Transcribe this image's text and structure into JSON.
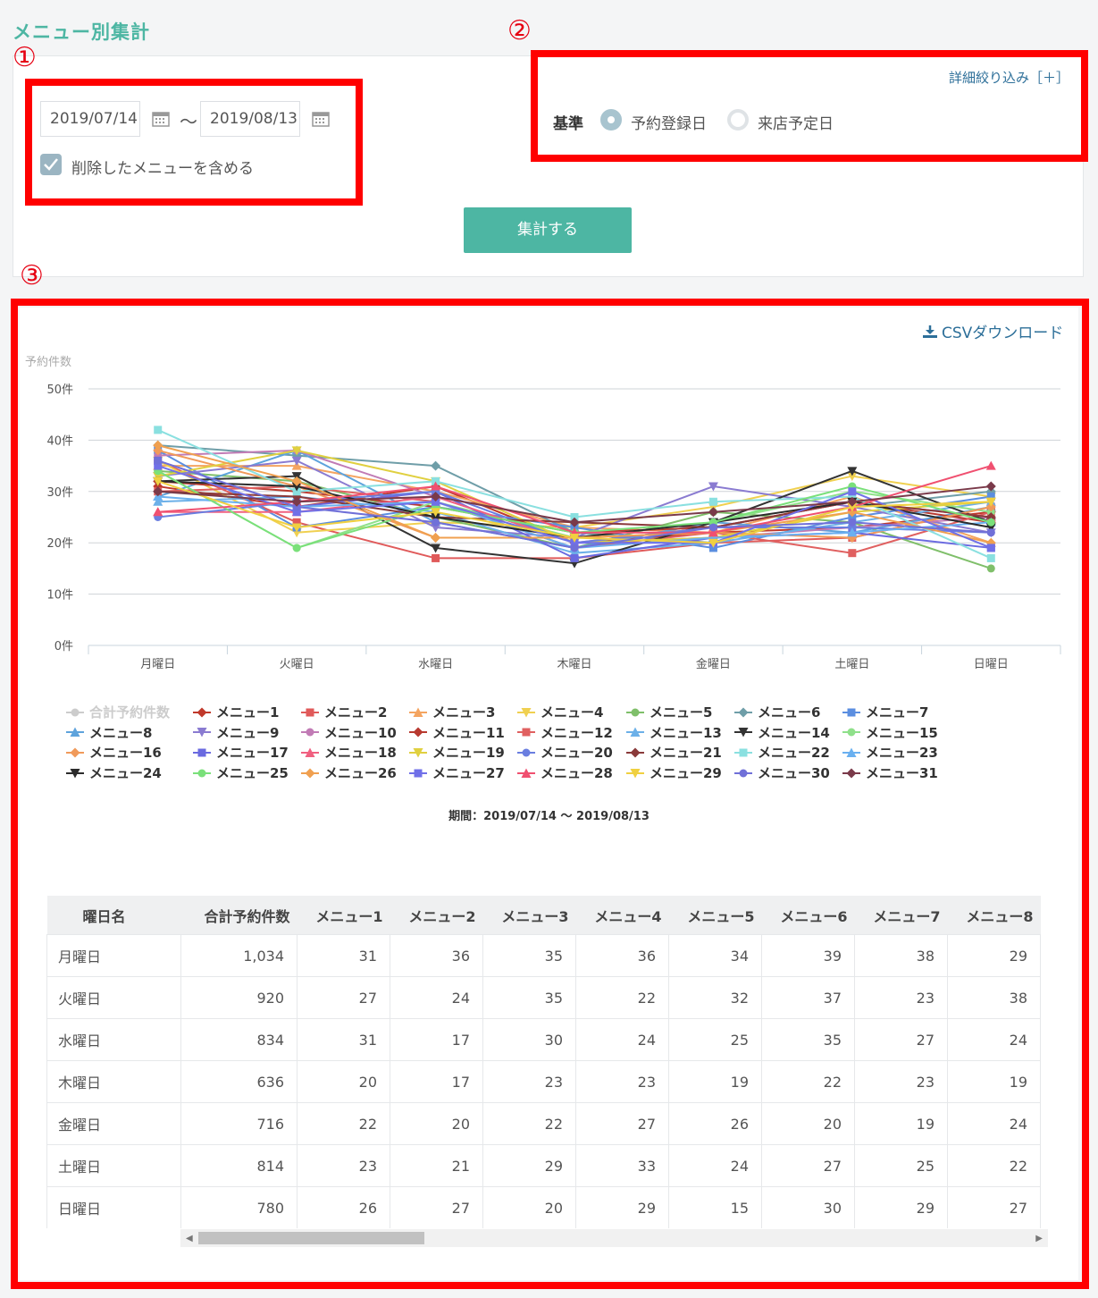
{
  "page": {
    "title": "メニュー別集計"
  },
  "markers": [
    "①",
    "②",
    "③"
  ],
  "filters": {
    "date_from": "2019/07/14",
    "tilde": "〜",
    "date_to": "2019/08/13",
    "include_deleted_label": "削除したメニューを含める",
    "include_deleted_checked": true,
    "detail_filter_link": "詳細絞り込み［＋］",
    "basis_label": "基準",
    "basis_options": [
      "予約登録日",
      "来店予定日"
    ],
    "basis_selected": "予約登録日",
    "submit_label": "集計する"
  },
  "result": {
    "csv_download_label": "CSVダウンロード",
    "period_text": "期間：2019/07/14 〜 2019/08/13"
  },
  "chart_data": {
    "type": "line",
    "ylabel": "予約件数",
    "ylim": [
      0,
      50
    ],
    "yticks": [
      "0件",
      "10件",
      "20件",
      "30件",
      "40件",
      "50件"
    ],
    "categories": [
      "月曜日",
      "火曜日",
      "水曜日",
      "木曜日",
      "金曜日",
      "土曜日",
      "日曜日"
    ],
    "legend_hidden": "合計予約件数",
    "series": [
      {
        "name": "合計予約件数",
        "color": "#cccccc",
        "marker": "circle",
        "visible": false,
        "values": [
          1034,
          920,
          834,
          636,
          716,
          814,
          780
        ]
      },
      {
        "name": "メニュー1",
        "color": "#c0392b",
        "marker": "diamond",
        "values": [
          31,
          27,
          31,
          20,
          22,
          23,
          26
        ]
      },
      {
        "name": "メニュー2",
        "color": "#e05a5a",
        "marker": "square",
        "values": [
          36,
          24,
          17,
          17,
          20,
          21,
          27
        ]
      },
      {
        "name": "メニュー3",
        "color": "#f4a460",
        "marker": "triangle",
        "values": [
          35,
          35,
          30,
          23,
          22,
          29,
          20
        ]
      },
      {
        "name": "メニュー4",
        "color": "#f0d050",
        "marker": "triangle-down",
        "values": [
          36,
          22,
          24,
          23,
          27,
          33,
          29
        ]
      },
      {
        "name": "メニュー5",
        "color": "#7fbf6a",
        "marker": "circle",
        "values": [
          34,
          32,
          25,
          19,
          26,
          24,
          15
        ]
      },
      {
        "name": "メニュー6",
        "color": "#6f9ea8",
        "marker": "diamond",
        "values": [
          39,
          37,
          35,
          22,
          20,
          27,
          30
        ]
      },
      {
        "name": "メニュー7",
        "color": "#5b8ee0",
        "marker": "square",
        "values": [
          38,
          23,
          27,
          23,
          19,
          25,
          29
        ]
      },
      {
        "name": "メニュー8",
        "color": "#5ea3dc",
        "marker": "triangle",
        "values": [
          29,
          38,
          24,
          19,
          24,
          22,
          27
        ]
      },
      {
        "name": "メニュー9",
        "color": "#8a7bd1",
        "marker": "triangle-down",
        "values": [
          33,
          36,
          23,
          21,
          31,
          27,
          22
        ]
      },
      {
        "name": "メニュー10",
        "color": "#c17bb5",
        "marker": "circle",
        "values": [
          37,
          38,
          29,
          20,
          21,
          23,
          25
        ]
      },
      {
        "name": "メニュー11",
        "color": "#b83a30",
        "marker": "diamond",
        "values": [
          32,
          30,
          27,
          22,
          23,
          28,
          24
        ]
      },
      {
        "name": "メニュー12",
        "color": "#e06060",
        "marker": "square",
        "values": [
          30,
          31,
          28,
          19,
          22,
          18,
          26
        ]
      },
      {
        "name": "メニュー13",
        "color": "#6cb0e8",
        "marker": "triangle",
        "values": [
          28,
          29,
          26,
          18,
          20,
          24,
          28
        ]
      },
      {
        "name": "メニュー14",
        "color": "#333333",
        "marker": "triangle-down",
        "values": [
          32,
          33,
          19,
          16,
          24,
          34,
          24
        ]
      },
      {
        "name": "メニュー15",
        "color": "#8fe08a",
        "marker": "circle",
        "values": [
          34,
          19,
          28,
          21,
          24,
          30,
          26
        ]
      },
      {
        "name": "メニュー16",
        "color": "#f09a5a",
        "marker": "diamond",
        "values": [
          38,
          31,
          21,
          21,
          22,
          21,
          27
        ]
      },
      {
        "name": "メニュー17",
        "color": "#6a6ae0",
        "marker": "square",
        "values": [
          36,
          27,
          30,
          17,
          21,
          22,
          19
        ]
      },
      {
        "name": "メニュー18",
        "color": "#f06080",
        "marker": "triangle",
        "values": [
          26,
          26,
          29,
          20,
          23,
          28,
          25
        ]
      },
      {
        "name": "メニュー19",
        "color": "#e0d040",
        "marker": "triangle-down",
        "values": [
          33,
          38,
          32,
          20,
          21,
          26,
          28
        ]
      },
      {
        "name": "メニュー20",
        "color": "#6a7ee0",
        "marker": "circle",
        "values": [
          25,
          28,
          30,
          20,
          23,
          23,
          22
        ]
      },
      {
        "name": "メニュー21",
        "color": "#8a3a3a",
        "marker": "diamond",
        "values": [
          30,
          29,
          25,
          24,
          23,
          28,
          25
        ]
      },
      {
        "name": "メニュー22",
        "color": "#8ae0e0",
        "marker": "square",
        "values": [
          42,
          30,
          32,
          25,
          28,
          29,
          17
        ]
      },
      {
        "name": "メニュー23",
        "color": "#6ab0f0",
        "marker": "triangle",
        "values": [
          29,
          27,
          28,
          19,
          21,
          22,
          24
        ]
      },
      {
        "name": "メニュー24",
        "color": "#2b2b2b",
        "marker": "triangle-down",
        "values": [
          32,
          31,
          25,
          21,
          24,
          28,
          23
        ]
      },
      {
        "name": "メニュー25",
        "color": "#7ae07a",
        "marker": "circle",
        "values": [
          34,
          19,
          27,
          22,
          24,
          31,
          24
        ]
      },
      {
        "name": "メニュー26",
        "color": "#f0a050",
        "marker": "diamond",
        "values": [
          39,
          32,
          21,
          21,
          22,
          26,
          20
        ]
      },
      {
        "name": "メニュー27",
        "color": "#7070e8",
        "marker": "square",
        "values": [
          35,
          26,
          28,
          20,
          20,
          30,
          19
        ]
      },
      {
        "name": "メニュー28",
        "color": "#f05070",
        "marker": "triangle",
        "values": [
          26,
          28,
          31,
          22,
          22,
          27,
          35
        ]
      },
      {
        "name": "メニュー29",
        "color": "#f0d040",
        "marker": "triangle-down",
        "values": [
          32,
          23,
          26,
          21,
          20,
          27,
          28
        ]
      },
      {
        "name": "メニュー30",
        "color": "#7070d8",
        "marker": "circle",
        "values": [
          36,
          27,
          24,
          19,
          23,
          24,
          22
        ]
      },
      {
        "name": "メニュー31",
        "color": "#7a3a4a",
        "marker": "diamond",
        "values": [
          30,
          28,
          29,
          24,
          26,
          28,
          31
        ]
      }
    ]
  },
  "table": {
    "headers": [
      "曜日名",
      "合計予約件数",
      "メニュー1",
      "メニュー2",
      "メニュー3",
      "メニュー4",
      "メニュー5",
      "メニュー6",
      "メニュー7",
      "メニュー8"
    ],
    "rows": [
      [
        "月曜日",
        "1,034",
        "31",
        "36",
        "35",
        "36",
        "34",
        "39",
        "38",
        "29"
      ],
      [
        "火曜日",
        "920",
        "27",
        "24",
        "35",
        "22",
        "32",
        "37",
        "23",
        "38"
      ],
      [
        "水曜日",
        "834",
        "31",
        "17",
        "30",
        "24",
        "25",
        "35",
        "27",
        "24"
      ],
      [
        "木曜日",
        "636",
        "20",
        "17",
        "23",
        "23",
        "19",
        "22",
        "23",
        "19"
      ],
      [
        "金曜日",
        "716",
        "22",
        "20",
        "22",
        "27",
        "26",
        "20",
        "19",
        "24"
      ],
      [
        "土曜日",
        "814",
        "23",
        "21",
        "29",
        "33",
        "24",
        "27",
        "25",
        "22"
      ],
      [
        "日曜日",
        "780",
        "26",
        "27",
        "20",
        "29",
        "15",
        "30",
        "29",
        "27"
      ]
    ],
    "scroll_left_glyph": "◀",
    "scroll_right_glyph": "▶"
  },
  "icons": {
    "calendar": "calendar-icon",
    "check": "check-icon",
    "download": "download-icon"
  },
  "colors": {
    "accent": "#4db6a3",
    "highlight_box": "#ff0000",
    "link": "#2d6f99"
  }
}
